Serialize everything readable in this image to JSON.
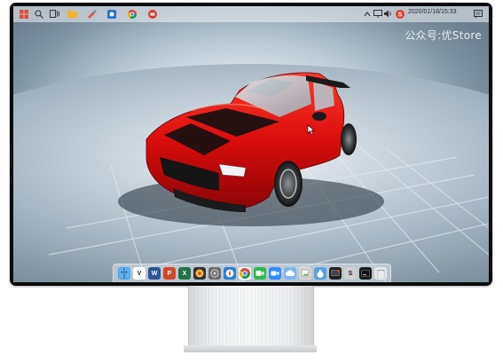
{
  "taskbar": {
    "left_icons": [
      "windows-icon",
      "search-icon",
      "task-view-icon",
      "folder-icon",
      "paint-icon",
      "app-icon",
      "chrome-icon",
      "media-icon"
    ],
    "tray_icons": [
      "chevron-up-icon",
      "network-icon",
      "volume-icon",
      "antivirus-icon"
    ],
    "datetime": "2020/01/18/15:33",
    "notification_icon": "notification-icon"
  },
  "watermark": "公众号:优Store",
  "dock": {
    "items": [
      {
        "name": "finder",
        "color": "#4aa3e8",
        "glyph": ""
      },
      {
        "name": "vectorworks",
        "color": "#ffffff",
        "glyph": "V"
      },
      {
        "name": "word",
        "color": "#2b579a",
        "glyph": "W"
      },
      {
        "name": "powerpoint",
        "color": "#d24726",
        "glyph": "P"
      },
      {
        "name": "excel",
        "color": "#217346",
        "glyph": "X"
      },
      {
        "name": "photos",
        "color": "#333333",
        "glyph": ""
      },
      {
        "name": "settings",
        "color": "#6b6b6b",
        "glyph": ""
      },
      {
        "name": "safari",
        "color": "#2b7fd6",
        "glyph": ""
      },
      {
        "name": "chrome",
        "color": "#ffffff",
        "glyph": ""
      },
      {
        "name": "facetime",
        "color": "#2dbb49",
        "glyph": ""
      },
      {
        "name": "zoom",
        "color": "#2d8cff",
        "glyph": ""
      },
      {
        "name": "cloud",
        "color": "#7fb6ea",
        "glyph": ""
      },
      {
        "name": "preview",
        "color": "#d8d8d8",
        "glyph": ""
      },
      {
        "name": "drop",
        "color": "#5aa0e0",
        "glyph": ""
      },
      {
        "name": "screen-recorder",
        "color": "#222222",
        "glyph": ""
      },
      {
        "name": "sketch",
        "color": "#cfcfcf",
        "glyph": "S"
      },
      {
        "name": "terminal",
        "color": "#1a1a1a",
        "glyph": ""
      },
      {
        "name": "trash",
        "color": "#e6e6e6",
        "glyph": ""
      }
    ]
  },
  "colors": {
    "car_body": "#e01010",
    "car_stripe": "#111111",
    "floor_grid": "#dfe7ee",
    "background": "#cfdbe3"
  }
}
